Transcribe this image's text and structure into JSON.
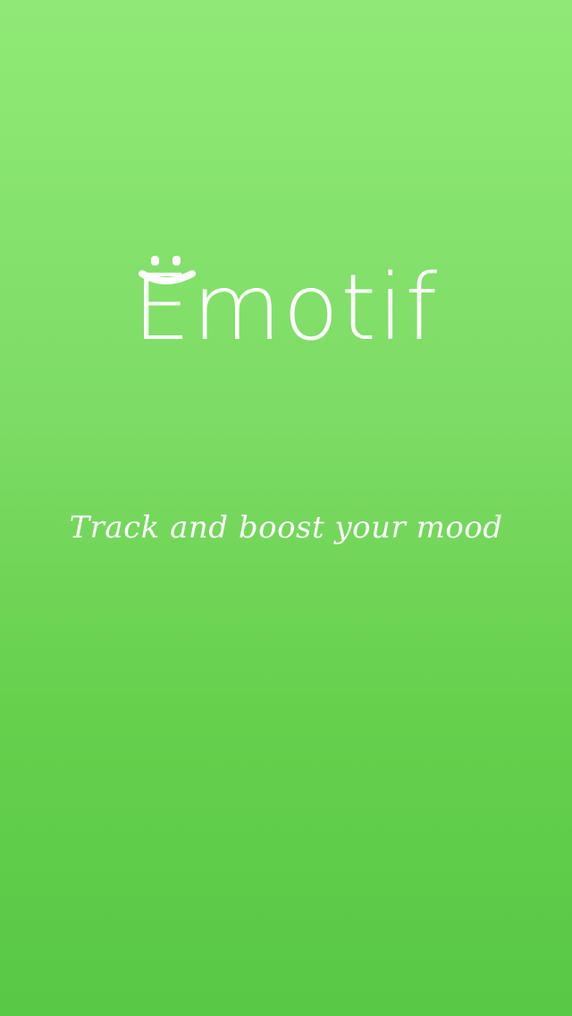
{
  "splash": {
    "logo_text": "Emotif",
    "tagline": "Track and boost your mood",
    "logo_mark_icon": "smile-icon"
  },
  "colors": {
    "background_top": "#90e976",
    "background_bottom": "#58c847",
    "text": "#ffffff"
  }
}
